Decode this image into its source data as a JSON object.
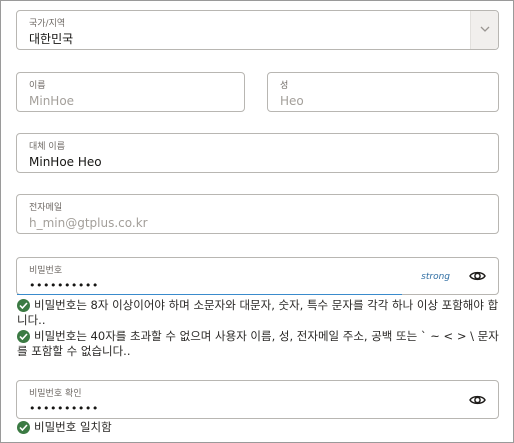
{
  "country": {
    "label": "국가/지역",
    "value": "대한민국",
    "dropdown_icon": "chevron-down-icon"
  },
  "first_name": {
    "label": "이름",
    "value": "MinHoe"
  },
  "last_name": {
    "label": "성",
    "value": "Heo"
  },
  "alternate_name": {
    "label": "대체 이름",
    "value": "MinHoe Heo"
  },
  "email": {
    "label": "전자메일",
    "value": "h_min@gtplus.co.kr"
  },
  "password": {
    "label": "비밀번호",
    "value": "••••••••••",
    "strength": "strong",
    "toggle_icon": "eye-icon"
  },
  "password_rules": [
    {
      "icon": "check-circle-icon",
      "text": "비밀번호는 8자 이상이어야 하며 소문자와 대문자, 숫자, 특수 문자를 각각 하나 이상 포함해야 합니다.."
    },
    {
      "icon": "check-circle-icon",
      "text": "비밀번호는 40자를 초과할 수 없으며 사용자 이름, 성, 전자메일 주소, 공백 또는 ` ~ < > \\ 문자를 포함할 수 없습니다.."
    }
  ],
  "confirm_password": {
    "label": "비밀번호 확인",
    "value": "••••••••••",
    "toggle_icon": "eye-icon"
  },
  "match_status": {
    "icon": "check-circle-icon",
    "text": "비밀번호 일치함"
  },
  "colors": {
    "accent_blue": "#3a8bcc",
    "success_green": "#3b7a43",
    "border": "#b8b6b2"
  }
}
